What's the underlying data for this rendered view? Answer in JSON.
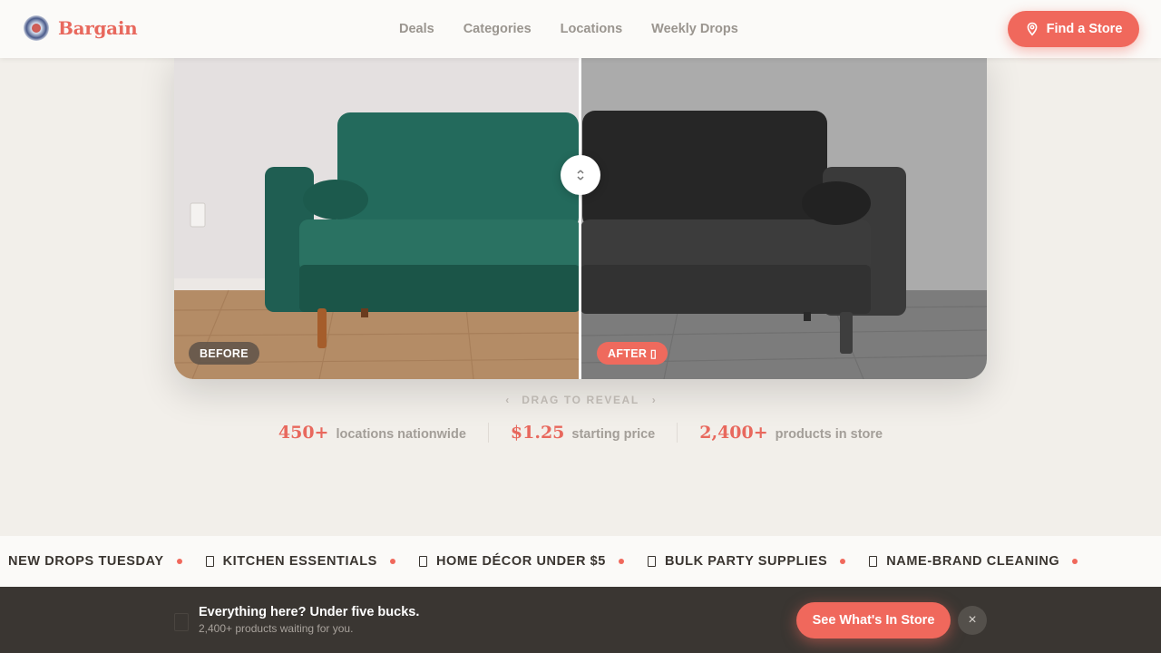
{
  "brand": {
    "name": "Bargain",
    "accent": "#f0685c"
  },
  "nav": {
    "items": [
      {
        "label": "Deals"
      },
      {
        "label": "Categories"
      },
      {
        "label": "Locations"
      },
      {
        "label": "Weekly Drops"
      }
    ]
  },
  "header": {
    "cta_label": "Find a Store",
    "cta_icon": "map-pin-icon"
  },
  "compare": {
    "before_label": "BEFORE",
    "after_label": "AFTER ▯",
    "handle_icon": "drag-arrows-icon",
    "position_pct": 50,
    "hint": "DRAG TO REVEAL",
    "hint_left": "‹",
    "hint_right": "›"
  },
  "stats": [
    {
      "value": "450+",
      "label": "locations nationwide"
    },
    {
      "value": "$1.25",
      "label": "starting price"
    },
    {
      "value": "2,400+",
      "label": "products in store"
    }
  ],
  "ticker": {
    "items": [
      {
        "label": "NEW DROPS TUESDAY"
      },
      {
        "label": "KITCHEN ESSENTIALS"
      },
      {
        "label": "HOME DÉCOR UNDER $5"
      },
      {
        "label": "BULK PARTY SUPPLIES"
      },
      {
        "label": "NAME-BRAND CLEANING"
      }
    ]
  },
  "footer_bar": {
    "title": "Everything here? Under five bucks.",
    "subtitle": "2,400+ products waiting for you.",
    "cta_label": "See What's In Store",
    "close_label": "×"
  }
}
